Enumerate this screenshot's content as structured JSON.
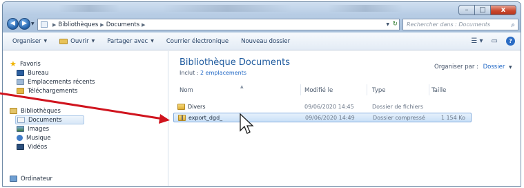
{
  "address": {
    "crumbs": [
      "Bibliothèques",
      "Documents"
    ],
    "search_placeholder": "Rechercher dans : Documents"
  },
  "window_controls": {
    "minimize": "–",
    "maximize": "□",
    "close": "x"
  },
  "toolbar": {
    "organize": "Organiser",
    "open": "Ouvrir",
    "share": "Partager avec",
    "email": "Courrier électronique",
    "new_folder": "Nouveau dossier"
  },
  "nav": {
    "favorites": "Favoris",
    "desktop": "Bureau",
    "recent": "Emplacements récents",
    "downloads": "Téléchargements",
    "libraries": "Bibliothèques",
    "documents": "Documents",
    "images": "Images",
    "music": "Musique",
    "videos": "Vidéos",
    "computer": "Ordinateur"
  },
  "library": {
    "title": "Bibliothèque Documents",
    "includes_label": "Inclut : ",
    "includes_link": "2 emplacements",
    "arrange_label": "Organiser par :",
    "arrange_value": "Dossier"
  },
  "columns": {
    "name": "Nom",
    "modified": "Modifié le",
    "type": "Type",
    "size": "Taille"
  },
  "files": [
    {
      "name": "Divers",
      "modified": "09/06/2020 14:45",
      "type": "Dossier de fichiers",
      "size": ""
    },
    {
      "name": "export_dgd_",
      "modified": "09/06/2020 14:49",
      "type": "Dossier compressé",
      "size": "1 154 Ko"
    }
  ],
  "colors": {
    "accent": "#1e5a9e",
    "annotation_arrow": "#d0141e",
    "selection": "#c9e0f7"
  }
}
